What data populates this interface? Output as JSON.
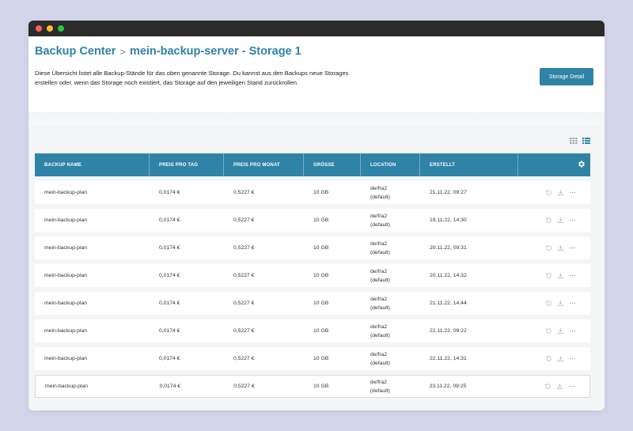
{
  "breadcrumb": {
    "root": "Backup Center",
    "separator": ">",
    "current": "mein-backup-server - Storage 1"
  },
  "description": {
    "line1": "Diese Übersicht listet alle Backup-Stände für das oben genannte Storage. Du kannst aus den Backups neue Storages",
    "line2": "erstellen oder, wenn das Storage noch existiert, das Storage auf den jeweiligen Stand zurückrollen."
  },
  "storage_detail_label": "Storage Detail",
  "view_toggles": {
    "grid_icon": "grid-icon",
    "list_icon": "list-icon",
    "active": "list"
  },
  "table": {
    "columns": [
      "BACKUP NAME",
      "PREIS PRO TAG",
      "PREIS PRO MONAT",
      "GRÖSSE",
      "LOCATION",
      "ERSTELLT"
    ],
    "settings_icon": "gear-icon",
    "rows": [
      {
        "name": "mein-backup-plan",
        "preis_tag": "0,0174 €",
        "preis_monat": "0,5227 €",
        "groesse": "10 GB",
        "location_1": "de/fra2",
        "location_2": "(default)",
        "erstellt": "21.11.22, 09:27"
      },
      {
        "name": "mein-backup-plan",
        "preis_tag": "0,0174 €",
        "preis_monat": "0,5227 €",
        "groesse": "10 GB",
        "location_1": "de/fra2",
        "location_2": "(default)",
        "erstellt": "19.11.22, 14:30"
      },
      {
        "name": "mein-backup-plan",
        "preis_tag": "0,0174 €",
        "preis_monat": "0,5227 €",
        "groesse": "10 GB",
        "location_1": "de/fra2",
        "location_2": "(default)",
        "erstellt": "20.11.22, 09:31"
      },
      {
        "name": "mein-backup-plan",
        "preis_tag": "0,0174 €",
        "preis_monat": "0,5227 €",
        "groesse": "10 GB",
        "location_1": "de/fra2",
        "location_2": "(default)",
        "erstellt": "20.11.22, 14:32"
      },
      {
        "name": "mein-backup-plan",
        "preis_tag": "0,0174 €",
        "preis_monat": "0,5227 €",
        "groesse": "10 GB",
        "location_1": "de/fra2",
        "location_2": "(default)",
        "erstellt": "21.11.22, 14:44"
      },
      {
        "name": "mein-backup-plan",
        "preis_tag": "0,0174 €",
        "preis_monat": "0,5227 €",
        "groesse": "10 GB",
        "location_1": "de/fra2",
        "location_2": "(default)",
        "erstellt": "22.11.22, 09:22"
      },
      {
        "name": "mein-backup-plan",
        "preis_tag": "0,0174 €",
        "preis_monat": "0,5227 €",
        "groesse": "10 GB",
        "location_1": "de/fra2",
        "location_2": "(default)",
        "erstellt": "22.11.22, 14:31"
      },
      {
        "name": "mein-backup-plan",
        "preis_tag": "0,0174 €",
        "preis_monat": "0,5227 €",
        "groesse": "10 GB",
        "location_1": "de/fra2",
        "location_2": "(default)",
        "erstellt": "23.11.22, 09:25"
      }
    ],
    "row_action_icons": [
      "restore-icon",
      "download-icon",
      "more-icon"
    ]
  },
  "colors": {
    "accent": "#2f83a6",
    "background": "#d3d6ea",
    "titlebar": "#2b2b2b"
  }
}
